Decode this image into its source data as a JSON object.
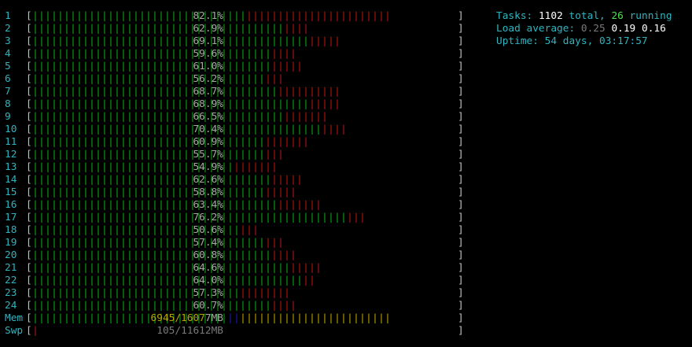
{
  "window": {
    "background": "#000000",
    "theme_colors": {
      "label": "#2cb5c0",
      "cpu_normal": "#14a314",
      "cpu_kernel": "#b01818",
      "mem_cache": "#b8a400",
      "mem_buffers": "#1a1aa8"
    }
  },
  "cpus": [
    {
      "label": "1",
      "green": 34,
      "red": 23,
      "percent": "82.1%"
    },
    {
      "label": "2",
      "green": 40,
      "red": 4,
      "percent": "62.9%"
    },
    {
      "label": "3",
      "green": 44,
      "red": 5,
      "percent": "69.1%"
    },
    {
      "label": "4",
      "green": 38,
      "red": 4,
      "percent": "59.6%"
    },
    {
      "label": "5",
      "green": 38,
      "red": 5,
      "percent": "61.0%"
    },
    {
      "label": "6",
      "green": 37,
      "red": 3,
      "percent": "56.2%"
    },
    {
      "label": "7",
      "green": 39,
      "red": 10,
      "percent": "68.7%"
    },
    {
      "label": "8",
      "green": 44,
      "red": 5,
      "percent": "68.9%"
    },
    {
      "label": "9",
      "green": 40,
      "red": 7,
      "percent": "66.5%"
    },
    {
      "label": "10",
      "green": 46,
      "red": 4,
      "percent": "70.4%"
    },
    {
      "label": "11",
      "green": 37,
      "red": 7,
      "percent": "60.9%"
    },
    {
      "label": "12",
      "green": 37,
      "red": 3,
      "percent": "55.7%"
    },
    {
      "label": "13",
      "green": 32,
      "red": 7,
      "percent": "54.9%"
    },
    {
      "label": "14",
      "green": 38,
      "red": 5,
      "percent": "62.6%"
    },
    {
      "label": "15",
      "green": 37,
      "red": 5,
      "percent": "58.8%"
    },
    {
      "label": "16",
      "green": 39,
      "red": 7,
      "percent": "63.4%"
    },
    {
      "label": "17",
      "green": 50,
      "red": 3,
      "percent": "76.2%"
    },
    {
      "label": "18",
      "green": 33,
      "red": 3,
      "percent": "50.6%"
    },
    {
      "label": "19",
      "green": 37,
      "red": 3,
      "percent": "57.4%"
    },
    {
      "label": "20",
      "green": 38,
      "red": 4,
      "percent": "60.8%"
    },
    {
      "label": "21",
      "green": 41,
      "red": 5,
      "percent": "64.6%"
    },
    {
      "label": "22",
      "green": 43,
      "red": 2,
      "percent": "64.0%"
    },
    {
      "label": "23",
      "green": 33,
      "red": 8,
      "percent": "57.3%"
    },
    {
      "label": "24",
      "green": 38,
      "red": 4,
      "percent": "60.7%"
    }
  ],
  "memory": {
    "label": "Mem",
    "green": 31,
    "blue": 2,
    "yellow": 24,
    "value_prefix": "6945/1607",
    "value_suffix": "7MB"
  },
  "swap": {
    "label": "Swp",
    "red": 1,
    "value": "105/11612MB"
  },
  "bracket_open": "[",
  "bracket_close": "]",
  "tick_char": "|",
  "summary": {
    "tasks_label": "Tasks:",
    "tasks_total": "1102",
    "tasks_total_word": "total,",
    "tasks_running": "26",
    "tasks_running_word": "running",
    "load_label": "Load average:",
    "load_1": "0.25",
    "load_5": "0.19",
    "load_15": "0.16",
    "uptime_label": "Uptime:",
    "uptime_value": "54 days, 03:17:57"
  }
}
